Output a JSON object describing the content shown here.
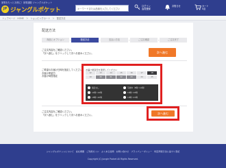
{
  "header": {
    "tagline": "家電をもっとお得に！家電通販 ジャングルポケット",
    "logo_mark": "JP",
    "logo_text": "ジャングルポケット",
    "search_placeholder": "キーワードまたは品番を入力してください",
    "nav": [
      {
        "label": "ログイン",
        "sub": "会員登録",
        "icon": "key-icon"
      },
      {
        "label": "お知らせ",
        "sub": "",
        "icon": "bell-icon"
      },
      {
        "label": "カート",
        "sub": "0点",
        "icon": "cart-icon"
      }
    ]
  },
  "breadcrumb": "トップページ　HOME　＞　ショッピングカート　＞　配送方法",
  "main": {
    "title": "配送方法",
    "steps": [
      "商品とオプション",
      "配送方法",
      "支払い方法",
      "ご注文確認",
      "ご注文完了"
    ],
    "section1_lines": [
      "ご注文内容をご確認ください。",
      "「次へ進む」をクリックして次へお進みください。"
    ],
    "next1_label": "次へ進む",
    "section2_lines": [
      "ご希望のお届け日時を指定してください。",
      "お届け希望日",
      "お届け時間指定"
    ],
    "next2_label": "次へ進む",
    "section3_lines": [
      "ご注文内容をご確認ください。",
      "「次へ進む」をクリックして次へお進みください。"
    ]
  },
  "datepicker": {
    "header": "お届け希望日を選択してください",
    "days": [
      "12",
      "13",
      "14",
      "15",
      "16",
      "17",
      "18",
      "19",
      "20",
      "21",
      "22",
      "23",
      "24",
      "25"
    ],
    "dark_days": [
      "20",
      "21",
      "22",
      "23"
    ],
    "selected_day": "18",
    "time_options": [
      "指定なし",
      "午前中（8時〜12時）",
      "14時〜16時",
      "16時〜18時",
      "18時〜20時",
      "19時〜21時"
    ]
  },
  "footer": {
    "links": "ジャングルポケットについて　会社概要　ご利用ガイド　よくある質問　お問い合わせ　プライバシーポリシー　特定商取引法に基づく表記",
    "copyright": "Copyright (C) Jungle Pocket All Rights Reserved."
  },
  "colors": {
    "brand": "#2f3e8e",
    "accent": "#f07828",
    "highlight": "#e02020",
    "logo": "#f7c21a"
  }
}
